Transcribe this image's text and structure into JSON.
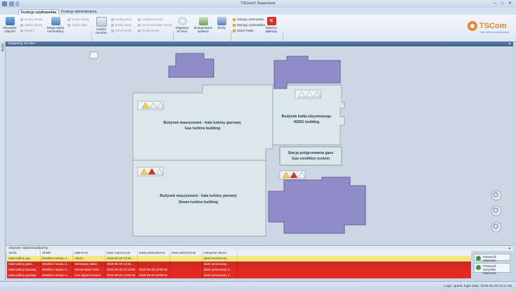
{
  "window": {
    "title": "TSCom2 Supervisor"
  },
  "tabs": [
    {
      "label": "Funkcje użytkownika",
      "active": true
    },
    {
      "label": "Funkcje administratora",
      "active": false
    }
  ],
  "ribbon": {
    "groups": [
      {
        "label": "Diagnostyka"
      },
      {
        "label": "Analiza danych"
      },
      {
        "label": "SCADA/Systemy/Strefy"
      },
      {
        "label": "Użytkownik"
      }
    ],
    "menedzer": "Menadżer zdarzeń",
    "diag_kom": "Diagnostyka komunikacji",
    "diag_small": [
      "Drukuj tabelę",
      "Zapisz tabelę",
      "Raport"
    ],
    "diag_small2": [
      "Drukuj tabelę",
      "Zapisz jako"
    ],
    "analiza": "Analiza trendów",
    "analiza_small": [
      "Dodaj panel",
      "Dodaj trend",
      "Usuń trendy",
      "Odśwież trendy",
      "Usuń wszystkie trendy",
      "Dodaj trendy"
    ],
    "diagramy": "Diagramy SCADA",
    "zintegrowane": "Zintegrowane systemy",
    "strefy": "Strefy",
    "user_items": [
      "Zaloguj użytkownika",
      "Wyloguj użytkownika",
      "Zmień hasło"
    ],
    "zakoncz": "Zakończ aplikacje"
  },
  "logo": {
    "text": "TSCom",
    "sub": "Total Safety Communication"
  },
  "scada": {
    "header": "Diagramy SCADA",
    "side_tab": "Strefy",
    "buildings": {
      "gas_turbine": [
        "Budynek maszynowni - hala turbiny gazowej.",
        "Gas turbine building"
      ],
      "hrsg": [
        "Budynek kotła odzyskowego",
        "HSRG building"
      ],
      "gas_condition": [
        "Stacja podgrzewania gazu",
        "Gas condition system"
      ],
      "steam_turbine": [
        "Budynek maszynowni - hala turbiny parowej",
        "Steam turbine building"
      ]
    }
  },
  "alarms": {
    "header": "Aktywne zdarzenia/alarmy",
    "columns": [
      "Strefa",
      "Obiekt",
      "Zdarzenie",
      "Data rozpoczęcia",
      "Data potwierdzenia",
      "Data zakończenia",
      "Kategoria alarmu"
    ],
    "rows": [
      {
        "cells": [
          "Hala turbiny gaz...",
          "Detektor metanu 1...",
          "Alarm I",
          "2015-05-29 13:19...",
          "",
          "",
          "alarm techniczny..."
        ],
        "color": "#f5e884",
        "text": "#1f2f4a"
      },
      {
        "cells": [
          "Hala turbiny gazo...",
          "Detektor metanu 2...",
          "Serwisowy alarm",
          "2015-05-29 13:18...",
          "",
          "",
          "alarm procesowy..."
        ],
        "color": "#cc2a24",
        "text": "#ffffff"
      },
      {
        "cells": [
          "Hala turbiny parowej",
          "Detektor metanu 4...",
          "Serwis alarm ośrb...",
          "2015-05-29 14:13:08",
          "2015-05-28 10:55:16",
          "",
          "alarm procesowy 4..."
        ],
        "color": "#e02a22",
        "text": "#ffffff"
      },
      {
        "cells": [
          "Hala turbiny parowej",
          "Detektor metanu 4...",
          "Line signal crossed",
          "2015-05-29 14:06:16",
          "2015-05-28 10:55:16",
          "",
          "alarm procesowy 4..."
        ],
        "color": "#e02a22",
        "text": "#ffffff"
      }
    ],
    "btn_confirm": "Potwierdź zdarzenie",
    "btn_confirm_all": "Potwierdź wszystkie zdarzenia"
  },
  "status": {
    "text": "Login: guest, login date: 2015-05-29 13:17:45"
  }
}
